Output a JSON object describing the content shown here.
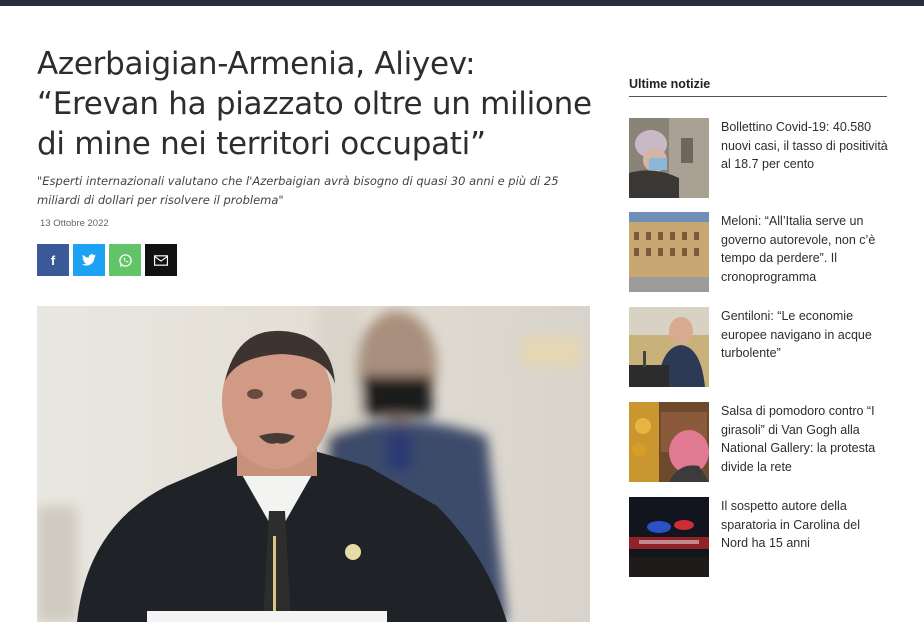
{
  "article": {
    "title": "Azerbaigian-Armenia, Aliyev: “Erevan ha piazzato oltre un milione di mine nei territori occupati”",
    "subtitle": "\"Esperti internazionali valutano che l'Azerbaigian avrà bisogno di quasi 30 anni e più di 25 miliardi di dollari per risolvere il problema\"",
    "date": "13 Ottobre 2022"
  },
  "share": [
    {
      "name": "facebook",
      "glyph": "f"
    },
    {
      "name": "twitter",
      "glyph": "🐦"
    },
    {
      "name": "whatsapp",
      "glyph": "✆"
    },
    {
      "name": "email",
      "glyph": "✉"
    }
  ],
  "sidebar": {
    "heading": "Ultime notizie",
    "items": [
      {
        "text": "Bollettino Covid-19: 40.580 nuovi casi, il tasso di positività al 18.7 per cento"
      },
      {
        "text": "Meloni: “All’Italia serve un governo autorevole, non c’è tempo da perdere”. Il cronoprogramma"
      },
      {
        "text": "Gentiloni: “Le economie europee navigano in acque turbolente”"
      },
      {
        "text": "Salsa di pomodoro contro “I girasoli” di Van Gogh alla National Gallery: la protesta divide la rete"
      },
      {
        "text": "Il sospetto autore della sparatoria in Carolina del Nord ha 15 anni"
      }
    ]
  },
  "colors": {
    "topbar": "#2a2e3a",
    "facebook": "#3b5998",
    "twitter": "#1da1f2",
    "whatsapp": "#62c466",
    "email": "#111111"
  }
}
